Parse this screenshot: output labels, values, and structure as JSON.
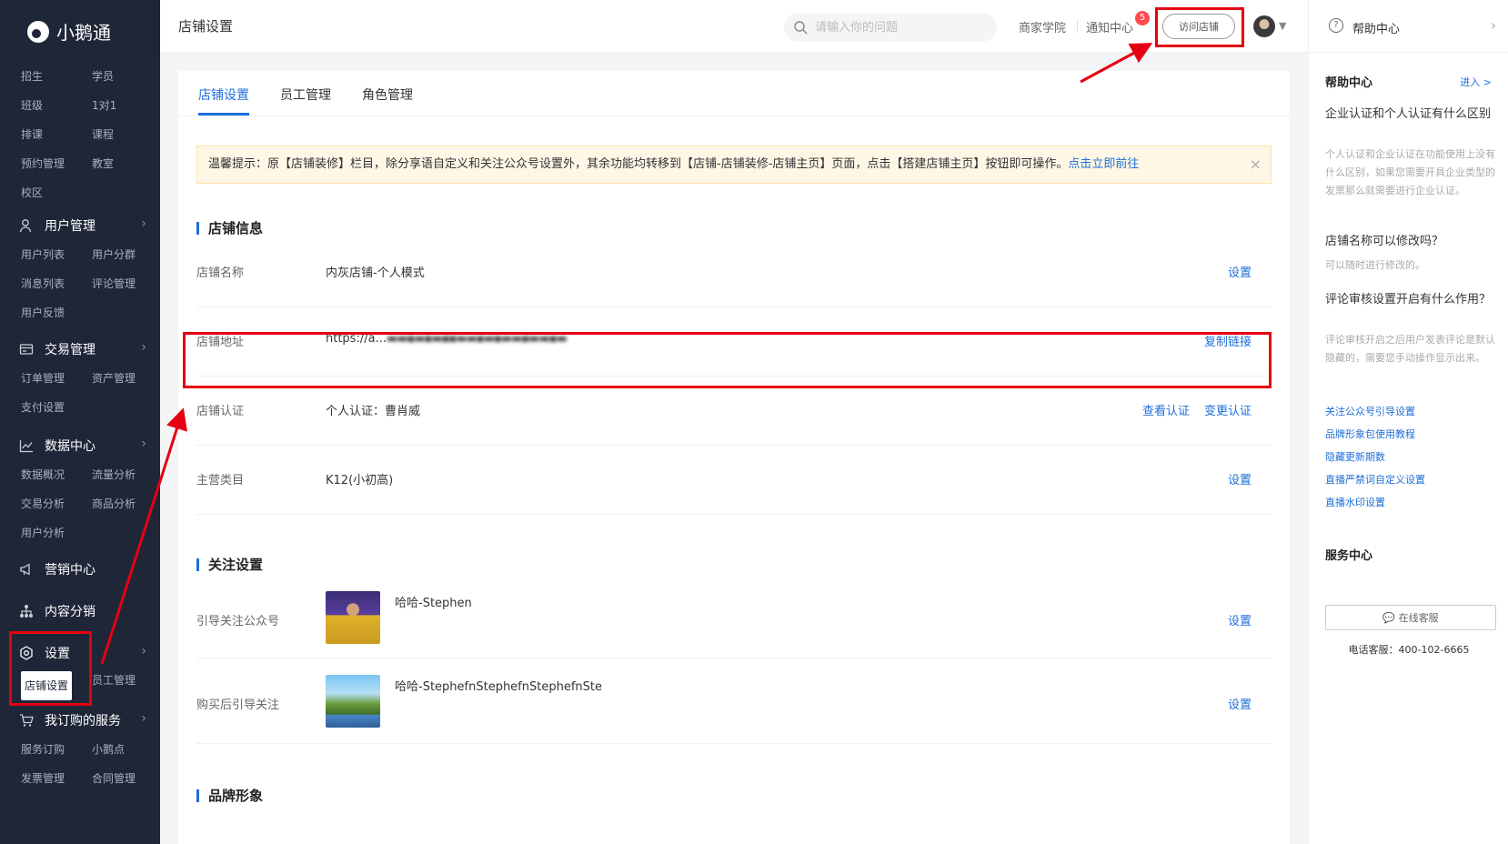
{
  "brand": {
    "name": "小鹅通"
  },
  "sidebar": {
    "groups_top": [
      [
        "招生",
        "学员"
      ],
      [
        "班级",
        "1对1"
      ],
      [
        "排课",
        "课程"
      ],
      [
        "预约管理",
        "教室"
      ],
      [
        "校区",
        ""
      ]
    ],
    "user_mgmt": {
      "title": "用户管理",
      "items": [
        [
          "用户列表",
          "用户分群"
        ],
        [
          "消息列表",
          "评论管理"
        ],
        [
          "用户反馈",
          ""
        ]
      ]
    },
    "trade_mgmt": {
      "title": "交易管理",
      "items": [
        [
          "订单管理",
          "资产管理"
        ],
        [
          "支付设置",
          ""
        ]
      ]
    },
    "data_center": {
      "title": "数据中心",
      "items": [
        [
          "数据概况",
          "流量分析"
        ],
        [
          "交易分析",
          "商品分析"
        ],
        [
          "用户分析",
          ""
        ]
      ]
    },
    "marketing": {
      "title": "营销中心"
    },
    "distribution": {
      "title": "内容分销"
    },
    "settings": {
      "title": "设置",
      "active": "店铺设置",
      "other": "员工管理"
    },
    "subscriptions": {
      "title": "我订购的服务",
      "items": [
        [
          "服务订购",
          "小鹅点"
        ],
        [
          "发票管理",
          "合同管理"
        ]
      ]
    }
  },
  "topbar": {
    "title": "店铺设置",
    "search_placeholder": "请输入你的问题",
    "academy": "商家学院",
    "notice": "通知中心",
    "notice_badge": "5",
    "visit_button": "访问店铺"
  },
  "tabs": [
    {
      "label": "店铺设置"
    },
    {
      "label": "员工管理"
    },
    {
      "label": "角色管理"
    }
  ],
  "notice_bar": {
    "text": "温馨提示：原【店铺装修】栏目，除分享语自定义和关注公众号设置外，其余功能均转移到【店铺-店铺装修-店铺主页】页面，点击【搭建店铺主页】按钮即可操作。",
    "link": "点击立即前往",
    "close": "×"
  },
  "shop_info": {
    "title": "店铺信息",
    "rows": [
      {
        "label": "店铺名称",
        "value": "内灰店铺-个人模式",
        "action": "设置"
      },
      {
        "label": "店铺地址",
        "value": "https://a...",
        "action": "复制链接"
      },
      {
        "label": "店铺认证",
        "value": "个人认证：曹肖威",
        "action": "变更认证",
        "action2": "查看认证"
      },
      {
        "label": "主营类目",
        "value": "K12(小初高)",
        "action": "设置"
      }
    ]
  },
  "follow": {
    "title": "关注设置",
    "rows": [
      {
        "label": "引导关注公众号",
        "name": "哈哈-Stephen",
        "action": "设置"
      },
      {
        "label": "购买后引导关注",
        "name": "哈哈-StephefnStephefnStephefnSte",
        "action": "设置"
      }
    ]
  },
  "brand_section": {
    "title": "品牌形象"
  },
  "help": {
    "header": "帮助中心",
    "section_title": "帮助中心",
    "enter": "进入 >",
    "faqs": [
      {
        "q": "企业认证和个人认证有什么区别",
        "a": "个人认证和企业认证在功能使用上没有什么区别，如果您需要开具企业类型的发票那么就需要进行企业认证。"
      },
      {
        "q": "店铺名称可以修改吗？",
        "a": "可以随时进行修改的。"
      },
      {
        "q": "评论审核设置开启有什么作用？",
        "a": "评论审核开启之后用户发表评论是默认隐藏的，需要您手动操作显示出来。"
      }
    ],
    "links": [
      "关注公众号引导设置",
      "品牌形象包使用教程",
      "隐藏更新期数",
      "直播严禁词自定义设置",
      "直播水印设置"
    ],
    "service_title": "服务中心",
    "service_button": "在线客服",
    "phone_label": "电话客服：",
    "phone": "400-102-6665"
  }
}
